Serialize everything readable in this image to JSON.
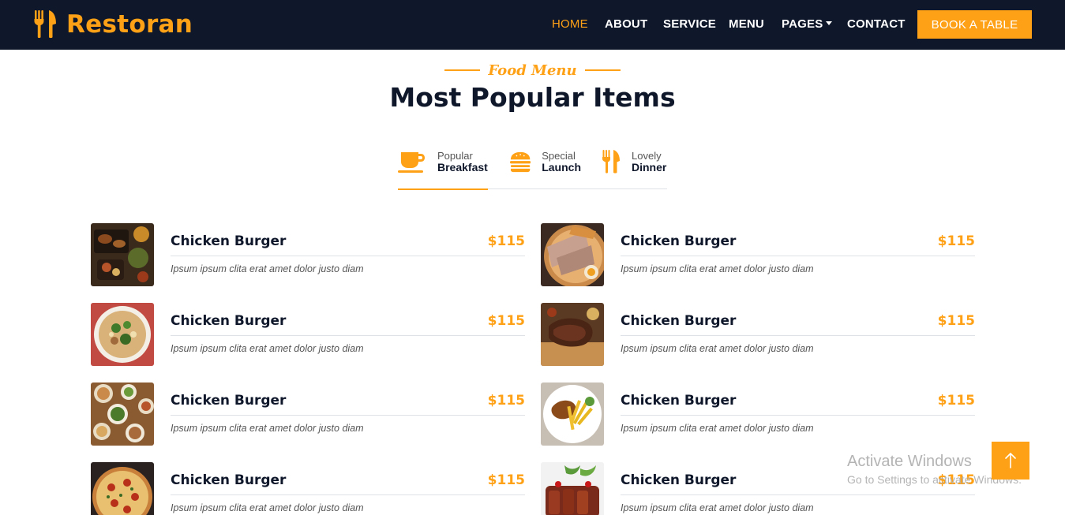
{
  "brand": {
    "name": "Restoran",
    "icon": "utensils-icon"
  },
  "nav": {
    "links": [
      "HOME",
      "ABOUT",
      "SERVICE",
      "MENU",
      "PAGES",
      "CONTACT"
    ],
    "active": "HOME",
    "book_label": "BOOK A TABLE"
  },
  "section": {
    "kicker": "Food Menu",
    "title": "Most Popular Items"
  },
  "tabs": [
    {
      "small": "Popular",
      "big": "Breakfast",
      "icon": "coffee-icon",
      "active": true
    },
    {
      "small": "Special",
      "big": "Launch",
      "icon": "hamburger-icon",
      "active": false
    },
    {
      "small": "Lovely",
      "big": "Dinner",
      "icon": "utensils-icon",
      "active": false
    }
  ],
  "menu": {
    "left": [
      {
        "name": "Chicken Burger",
        "price": "$115",
        "desc": "Ipsum ipsum clita erat amet dolor justo diam",
        "image": "grilled-platter-image"
      },
      {
        "name": "Chicken Burger",
        "price": "$115",
        "desc": "Ipsum ipsum clita erat amet dolor justo diam",
        "image": "salad-bowl-image"
      },
      {
        "name": "Chicken Burger",
        "price": "$115",
        "desc": "Ipsum ipsum clita erat amet dolor justo diam",
        "image": "table-spread-image"
      },
      {
        "name": "Chicken Burger",
        "price": "$115",
        "desc": "Ipsum ipsum clita erat amet dolor justo diam",
        "image": "pizza-image"
      }
    ],
    "right": [
      {
        "name": "Chicken Burger",
        "price": "$115",
        "desc": "Ipsum ipsum clita erat amet dolor justo diam",
        "image": "ramen-image"
      },
      {
        "name": "Chicken Burger",
        "price": "$115",
        "desc": "Ipsum ipsum clita erat amet dolor justo diam",
        "image": "steak-image"
      },
      {
        "name": "Chicken Burger",
        "price": "$115",
        "desc": "Ipsum ipsum clita erat amet dolor justo diam",
        "image": "fries-plate-image"
      },
      {
        "name": "Chicken Burger",
        "price": "$115",
        "desc": "Ipsum ipsum clita erat amet dolor justo diam",
        "image": "meat-salad-image"
      }
    ]
  },
  "watermark": {
    "title": "Activate Windows",
    "subtitle": "Go to Settings to activate Windows."
  },
  "colors": {
    "primary": "#fea116",
    "dark": "#0f172b",
    "text": "#555555"
  }
}
